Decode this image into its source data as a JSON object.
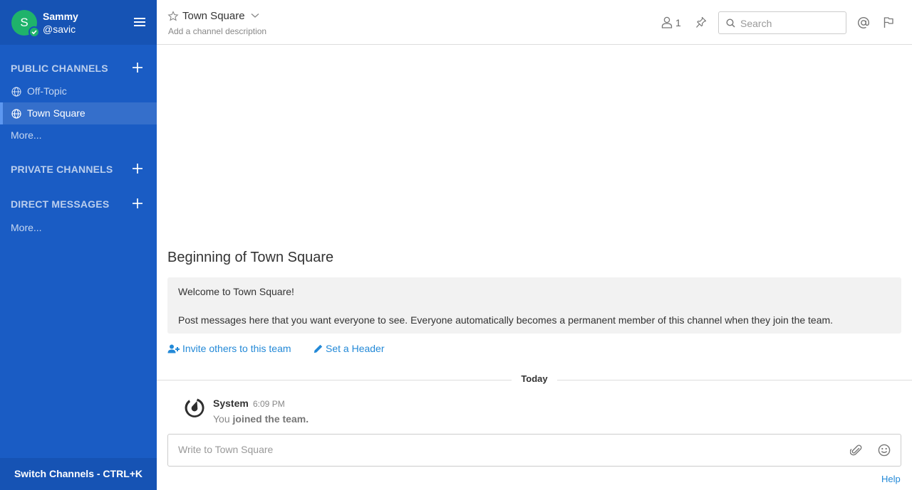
{
  "sidebar": {
    "user": {
      "initial": "S",
      "name": "Sammy",
      "handle": "@savic"
    },
    "public_channels": {
      "title": "PUBLIC CHANNELS",
      "items": [
        {
          "label": "Off-Topic",
          "active": false
        },
        {
          "label": "Town Square",
          "active": true
        }
      ],
      "more": "More..."
    },
    "private_channels": {
      "title": "PRIVATE CHANNELS"
    },
    "direct_messages": {
      "title": "DIRECT MESSAGES",
      "more": "More..."
    },
    "switch_channels": "Switch Channels - CTRL+K"
  },
  "header": {
    "channel_name": "Town Square",
    "description": "Add a channel description",
    "member_count": "1",
    "search_placeholder": "Search"
  },
  "intro": {
    "title": "Beginning of Town Square",
    "welcome": "Welcome to Town Square!",
    "text": "Post messages here that you want everyone to see. Everyone automatically becomes a permanent member of this channel when they join the team.",
    "invite_link": "Invite others to this team",
    "header_link": "Set a Header"
  },
  "timeline": {
    "date_separator": "Today",
    "post": {
      "user": "System",
      "time": "6:09 PM",
      "text_prefix": "You ",
      "text_bold": "joined the team."
    }
  },
  "composer": {
    "placeholder": "Write to Town Square"
  },
  "footer": {
    "help": "Help"
  },
  "colors": {
    "sidebar_bg": "#1a5cc4",
    "header_bg": "#1653b4",
    "avatar_bg": "#1fb36b",
    "link": "#2389d7"
  },
  "icons": [
    "hamburger-icon",
    "globe-icon",
    "plus-icon",
    "star-icon",
    "chevron-down-icon",
    "member-icon",
    "pin-icon",
    "search-icon",
    "at-mention-icon",
    "flag-icon",
    "add-user-icon",
    "pencil-icon",
    "mattermost-logo-icon",
    "paperclip-icon",
    "emoji-icon",
    "check-icon"
  ]
}
